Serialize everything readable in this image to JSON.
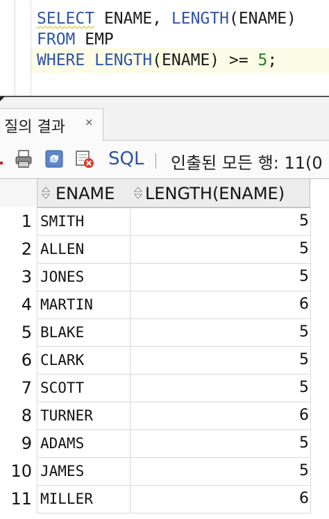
{
  "editor": {
    "line1": {
      "kw1": "SELECT",
      "mid": " ENAME, ",
      "kw2": "LENGTH",
      "rest": "(ENAME)"
    },
    "line2": {
      "kw1": "FROM",
      "rest": " EMP"
    },
    "line3": {
      "kw1": "WHERE",
      "sp": " ",
      "kw2": "LENGTH",
      "mid": "(ENAME) >= ",
      "num": "5",
      "end": ";"
    }
  },
  "tab": {
    "label": "질의 결과",
    "close": "×"
  },
  "toolbar": {
    "icons": [
      "pin-icon",
      "print-icon",
      "refresh-icon",
      "cancel-fetch-icon"
    ],
    "sql_label": "SQL",
    "separator": "|",
    "status": "인출된 모든 행: 11(0"
  },
  "grid": {
    "columns": [
      "ENAME",
      "LENGTH(ENAME)"
    ],
    "rows": [
      {
        "num": "1",
        "ename": "SMITH",
        "length": "5"
      },
      {
        "num": "2",
        "ename": "ALLEN",
        "length": "5"
      },
      {
        "num": "3",
        "ename": "JONES",
        "length": "5"
      },
      {
        "num": "4",
        "ename": "MARTIN",
        "length": "6"
      },
      {
        "num": "5",
        "ename": "BLAKE",
        "length": "5"
      },
      {
        "num": "6",
        "ename": "CLARK",
        "length": "5"
      },
      {
        "num": "7",
        "ename": "SCOTT",
        "length": "5"
      },
      {
        "num": "8",
        "ename": "TURNER",
        "length": "6"
      },
      {
        "num": "9",
        "ename": "ADAMS",
        "length": "5"
      },
      {
        "num": "10",
        "ename": "JAMES",
        "length": "5"
      },
      {
        "num": "11",
        "ename": "MILLER",
        "length": "6"
      }
    ]
  },
  "colors": {
    "keyword": "#2f55a4",
    "number": "#2a7a2a",
    "sql_link": "#2a54a8"
  }
}
